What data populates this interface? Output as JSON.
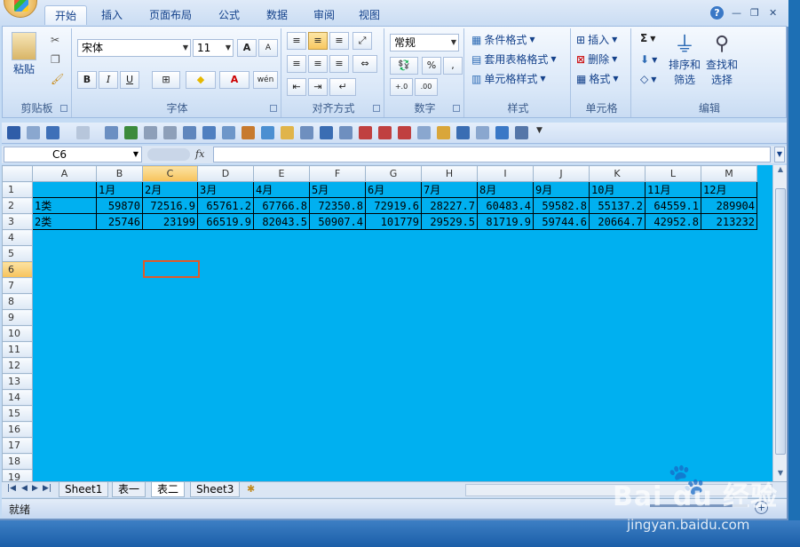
{
  "ribbon_tabs": [
    "开始",
    "插入",
    "页面布局",
    "公式",
    "数据",
    "审阅",
    "视图"
  ],
  "active_tab": "开始",
  "groups": {
    "clipboard": {
      "label": "剪贴板",
      "paste": "粘贴"
    },
    "font": {
      "label": "字体",
      "font_name": "宋体",
      "font_size": "11",
      "bold": "B",
      "italic": "I",
      "underline": "U",
      "grow": "A",
      "shrink": "A",
      "phonetic": "wén"
    },
    "alignment": {
      "label": "对齐方式"
    },
    "number": {
      "label": "数字",
      "format": "常规",
      "percent": "%",
      "comma": ",",
      "inc_decimal": "+.0",
      "dec_decimal": ".00"
    },
    "styles": {
      "label": "样式",
      "conditional": "条件格式",
      "table_format": "套用表格格式",
      "cell_styles": "单元格样式"
    },
    "cells": {
      "label": "单元格",
      "insert": "插入",
      "delete": "删除",
      "format": "格式"
    },
    "editing": {
      "label": "编辑",
      "sigma": "Σ",
      "sort": "排序和",
      "sort2": "筛选",
      "find": "查找和",
      "find2": "选择"
    }
  },
  "formula_bar": {
    "name_box": "C6",
    "fx": "fx",
    "formula": ""
  },
  "columns": [
    "A",
    "B",
    "C",
    "D",
    "E",
    "F",
    "G",
    "H",
    "I",
    "J",
    "K",
    "L",
    "M"
  ],
  "rows": [
    "1",
    "2",
    "3",
    "4",
    "5",
    "6",
    "7",
    "8",
    "9",
    "10",
    "11",
    "12",
    "13",
    "14",
    "15",
    "16",
    "17",
    "18",
    "19"
  ],
  "table": {
    "header": [
      "",
      "1月",
      "2月",
      "3月",
      "4月",
      "5月",
      "6月",
      "7月",
      "8月",
      "9月",
      "10月",
      "11月",
      "12月"
    ],
    "rows": [
      [
        "1类",
        "59870",
        "72516.9",
        "65761.2",
        "67766.8",
        "72350.8",
        "72919.6",
        "28227.7",
        "60483.4",
        "59582.8",
        "55137.2",
        "64559.1",
        "289904"
      ],
      [
        "2类",
        "25746",
        "23199",
        "66519.9",
        "82043.5",
        "50907.4",
        "101779",
        "29529.5",
        "81719.9",
        "59744.6",
        "20664.7",
        "42952.8",
        "213232"
      ]
    ]
  },
  "selected_cell": "C6",
  "sheet_tabs": [
    "Sheet1",
    "表一",
    "表二",
    "Sheet3"
  ],
  "active_sheet": "表二",
  "status": "就绪",
  "watermark": {
    "brand": "Bai du 经验",
    "url": "jingyan.baidu.com"
  },
  "colors": {
    "sheet_fill": "#00b0f0",
    "selection": "#e05a2a",
    "ribbon": "#c4dbf4"
  }
}
